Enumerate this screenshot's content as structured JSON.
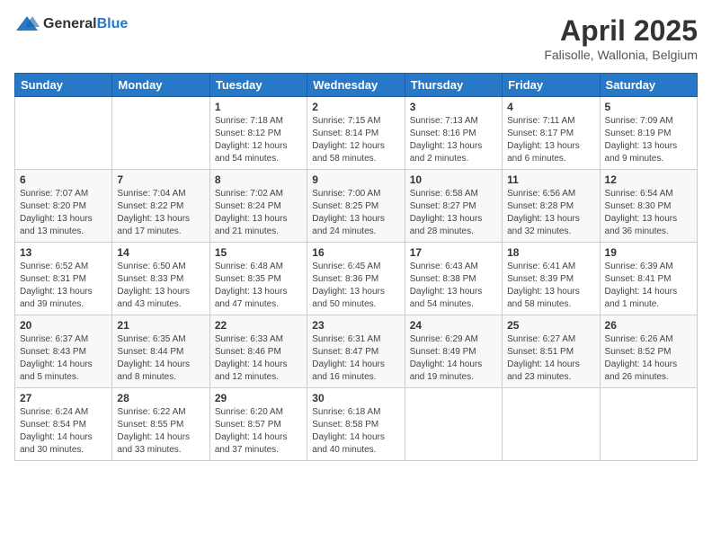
{
  "header": {
    "logo_general": "General",
    "logo_blue": "Blue",
    "month_title": "April 2025",
    "location": "Falisolle, Wallonia, Belgium"
  },
  "weekdays": [
    "Sunday",
    "Monday",
    "Tuesday",
    "Wednesday",
    "Thursday",
    "Friday",
    "Saturday"
  ],
  "weeks": [
    [
      {
        "day": "",
        "info": ""
      },
      {
        "day": "",
        "info": ""
      },
      {
        "day": "1",
        "info": "Sunrise: 7:18 AM\nSunset: 8:12 PM\nDaylight: 12 hours\nand 54 minutes."
      },
      {
        "day": "2",
        "info": "Sunrise: 7:15 AM\nSunset: 8:14 PM\nDaylight: 12 hours\nand 58 minutes."
      },
      {
        "day": "3",
        "info": "Sunrise: 7:13 AM\nSunset: 8:16 PM\nDaylight: 13 hours\nand 2 minutes."
      },
      {
        "day": "4",
        "info": "Sunrise: 7:11 AM\nSunset: 8:17 PM\nDaylight: 13 hours\nand 6 minutes."
      },
      {
        "day": "5",
        "info": "Sunrise: 7:09 AM\nSunset: 8:19 PM\nDaylight: 13 hours\nand 9 minutes."
      }
    ],
    [
      {
        "day": "6",
        "info": "Sunrise: 7:07 AM\nSunset: 8:20 PM\nDaylight: 13 hours\nand 13 minutes."
      },
      {
        "day": "7",
        "info": "Sunrise: 7:04 AM\nSunset: 8:22 PM\nDaylight: 13 hours\nand 17 minutes."
      },
      {
        "day": "8",
        "info": "Sunrise: 7:02 AM\nSunset: 8:24 PM\nDaylight: 13 hours\nand 21 minutes."
      },
      {
        "day": "9",
        "info": "Sunrise: 7:00 AM\nSunset: 8:25 PM\nDaylight: 13 hours\nand 24 minutes."
      },
      {
        "day": "10",
        "info": "Sunrise: 6:58 AM\nSunset: 8:27 PM\nDaylight: 13 hours\nand 28 minutes."
      },
      {
        "day": "11",
        "info": "Sunrise: 6:56 AM\nSunset: 8:28 PM\nDaylight: 13 hours\nand 32 minutes."
      },
      {
        "day": "12",
        "info": "Sunrise: 6:54 AM\nSunset: 8:30 PM\nDaylight: 13 hours\nand 36 minutes."
      }
    ],
    [
      {
        "day": "13",
        "info": "Sunrise: 6:52 AM\nSunset: 8:31 PM\nDaylight: 13 hours\nand 39 minutes."
      },
      {
        "day": "14",
        "info": "Sunrise: 6:50 AM\nSunset: 8:33 PM\nDaylight: 13 hours\nand 43 minutes."
      },
      {
        "day": "15",
        "info": "Sunrise: 6:48 AM\nSunset: 8:35 PM\nDaylight: 13 hours\nand 47 minutes."
      },
      {
        "day": "16",
        "info": "Sunrise: 6:45 AM\nSunset: 8:36 PM\nDaylight: 13 hours\nand 50 minutes."
      },
      {
        "day": "17",
        "info": "Sunrise: 6:43 AM\nSunset: 8:38 PM\nDaylight: 13 hours\nand 54 minutes."
      },
      {
        "day": "18",
        "info": "Sunrise: 6:41 AM\nSunset: 8:39 PM\nDaylight: 13 hours\nand 58 minutes."
      },
      {
        "day": "19",
        "info": "Sunrise: 6:39 AM\nSunset: 8:41 PM\nDaylight: 14 hours\nand 1 minute."
      }
    ],
    [
      {
        "day": "20",
        "info": "Sunrise: 6:37 AM\nSunset: 8:43 PM\nDaylight: 14 hours\nand 5 minutes."
      },
      {
        "day": "21",
        "info": "Sunrise: 6:35 AM\nSunset: 8:44 PM\nDaylight: 14 hours\nand 8 minutes."
      },
      {
        "day": "22",
        "info": "Sunrise: 6:33 AM\nSunset: 8:46 PM\nDaylight: 14 hours\nand 12 minutes."
      },
      {
        "day": "23",
        "info": "Sunrise: 6:31 AM\nSunset: 8:47 PM\nDaylight: 14 hours\nand 16 minutes."
      },
      {
        "day": "24",
        "info": "Sunrise: 6:29 AM\nSunset: 8:49 PM\nDaylight: 14 hours\nand 19 minutes."
      },
      {
        "day": "25",
        "info": "Sunrise: 6:27 AM\nSunset: 8:51 PM\nDaylight: 14 hours\nand 23 minutes."
      },
      {
        "day": "26",
        "info": "Sunrise: 6:26 AM\nSunset: 8:52 PM\nDaylight: 14 hours\nand 26 minutes."
      }
    ],
    [
      {
        "day": "27",
        "info": "Sunrise: 6:24 AM\nSunset: 8:54 PM\nDaylight: 14 hours\nand 30 minutes."
      },
      {
        "day": "28",
        "info": "Sunrise: 6:22 AM\nSunset: 8:55 PM\nDaylight: 14 hours\nand 33 minutes."
      },
      {
        "day": "29",
        "info": "Sunrise: 6:20 AM\nSunset: 8:57 PM\nDaylight: 14 hours\nand 37 minutes."
      },
      {
        "day": "30",
        "info": "Sunrise: 6:18 AM\nSunset: 8:58 PM\nDaylight: 14 hours\nand 40 minutes."
      },
      {
        "day": "",
        "info": ""
      },
      {
        "day": "",
        "info": ""
      },
      {
        "day": "",
        "info": ""
      }
    ]
  ]
}
